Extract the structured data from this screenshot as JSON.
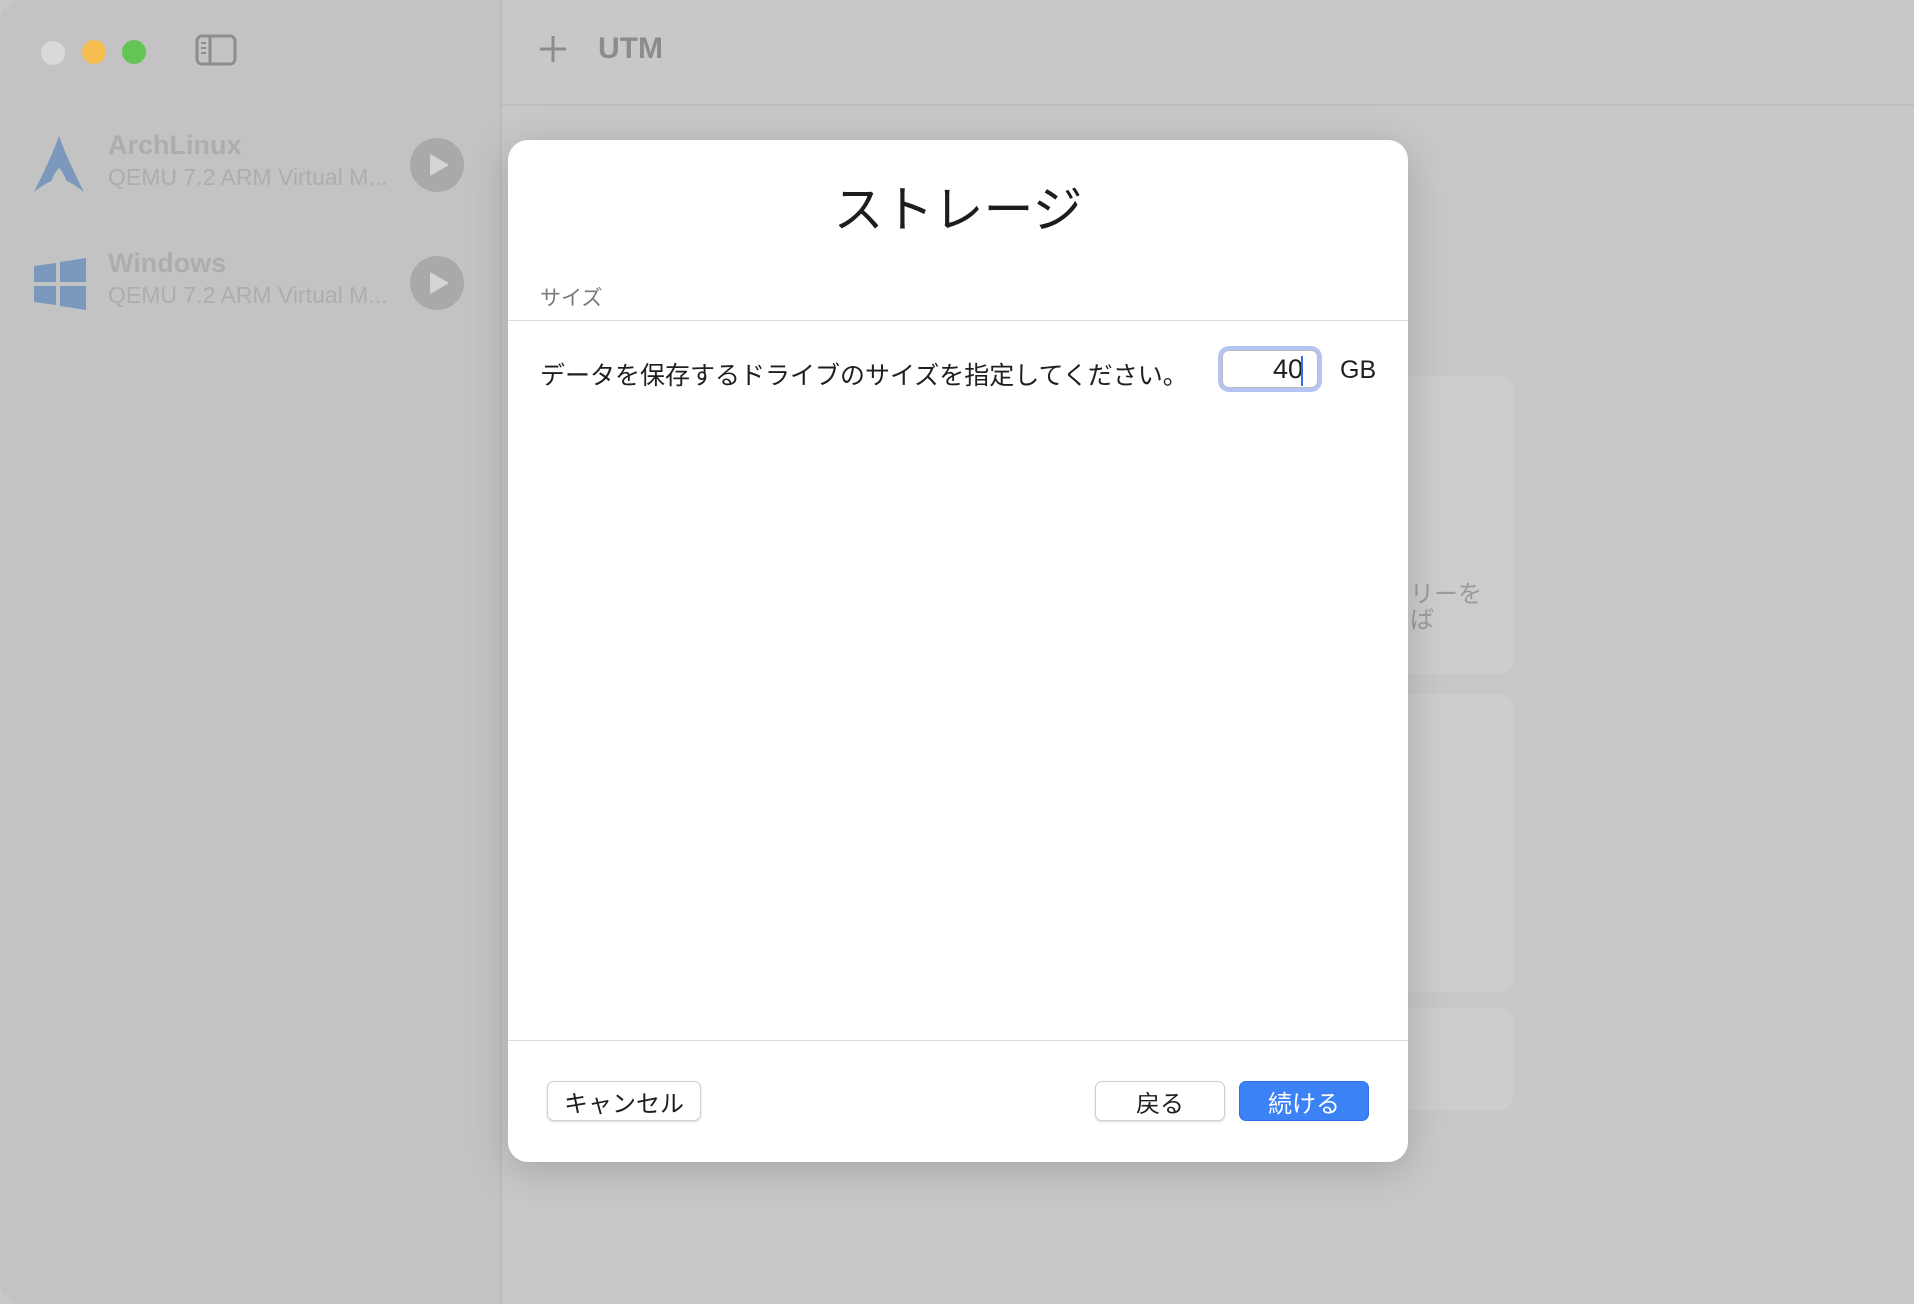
{
  "toolbar": {
    "title": "UTM"
  },
  "sidebar": {
    "vms": [
      {
        "name": "ArchLinux",
        "subtitle": "QEMU 7.2 ARM Virtual M...",
        "icon": "archlinux-icon"
      },
      {
        "name": "Windows",
        "subtitle": "QEMU 7.2 ARM Virtual M...",
        "icon": "windows-icon"
      }
    ]
  },
  "background": {
    "card_text_1": "リーを",
    "card_text_2": "ば"
  },
  "dialog": {
    "title": "ストレージ",
    "section": "サイズ",
    "prompt": "データを保存するドライブのサイズを指定してください。",
    "size_value": "40",
    "unit": "GB",
    "cancel_label": "キャンセル",
    "back_label": "戻る",
    "continue_label": "続ける"
  },
  "colors": {
    "accent": "#3a82f6",
    "close": "#d9d9d9",
    "minimize": "#f5be4f",
    "maximize": "#62c554"
  }
}
